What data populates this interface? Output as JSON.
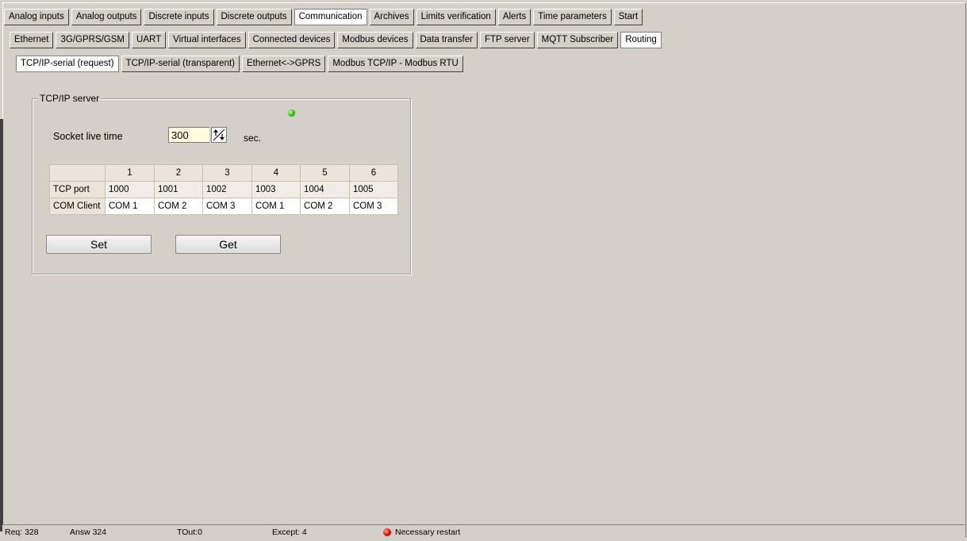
{
  "tabs_level1": [
    "Analog inputs",
    "Analog outputs",
    "Discrete inputs",
    "Discrete outputs",
    "Communication",
    "Archives",
    "Limits verification",
    "Alerts",
    "Time parameters",
    "Start"
  ],
  "tabs_level1_active": 4,
  "tabs_level2": [
    "Ethernet",
    "3G/GPRS/GSM",
    "UART",
    "Virtual interfaces",
    "Connected devices",
    "Modbus devices",
    "Data transfer",
    "FTP server",
    "MQTT Subscriber",
    "Routing"
  ],
  "tabs_level2_active": 9,
  "tabs_level3": [
    "TCP/IP-serial (request)",
    "TCP/IP-serial (transparent)",
    "Ethernet<->GPRS",
    "Modbus TCP/IP - Modbus RTU"
  ],
  "tabs_level3_active": 0,
  "group": {
    "title": "TCP/IP server",
    "status_led_color": "#1db800",
    "socket_label": "Socket live time",
    "socket_value": "300",
    "socket_unit": "sec.",
    "table": {
      "headers": [
        "",
        "1",
        "2",
        "3",
        "4",
        "5",
        "6"
      ],
      "rows": [
        {
          "label": "TCP port",
          "cells": [
            "1000",
            "1001",
            "1002",
            "1003",
            "1004",
            "1005"
          ]
        },
        {
          "label": "COM Client",
          "cells": [
            "COM 1",
            "COM 2",
            "COM 3",
            "COM 1",
            "COM 2",
            "COM 3"
          ]
        }
      ]
    },
    "set_label": "Set",
    "get_label": "Get"
  },
  "status": {
    "req": "Req: 328",
    "answ": "Answ   324",
    "tout": "TOut:0",
    "except": "Except:  4",
    "restart": "Necessary restart",
    "restart_led_color": "#e00000"
  }
}
